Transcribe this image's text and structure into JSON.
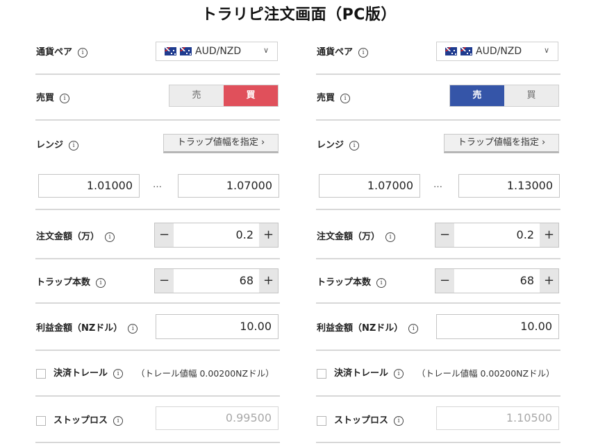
{
  "title": "トラリピ注文画面（PC版）",
  "labels": {
    "currency_pair": "通貨ペア",
    "buy_sell": "売買",
    "range": "レンジ",
    "order_amount": "注文金額（万）",
    "trap_count": "トラップ本数",
    "profit_amount": "利益金額（NZドル）",
    "trail": "決済トレール",
    "stop_loss": "ストップロス"
  },
  "info_symbol": "i",
  "sell_label": "売",
  "buy_label": "買",
  "range_button": "トラップ値幅を指定 ›",
  "range_dots": "…",
  "minus": "−",
  "plus": "+",
  "chevron": "∨",
  "colors": {
    "buy": "#e0505b",
    "sell": "#3555a8"
  },
  "panels": [
    {
      "pair": "AUD/NZD",
      "side_selected": "buy",
      "range_low": "1.01000",
      "range_high": "1.07000",
      "order_amount": "0.2",
      "trap_count": "68",
      "profit": "10.00",
      "trail_note": "（トレール値幅 0.00200NZドル）",
      "trail_checked": false,
      "stop_loss_checked": false,
      "stop_loss_value": "0.99500"
    },
    {
      "pair": "AUD/NZD",
      "side_selected": "sell",
      "range_low": "1.07000",
      "range_high": "1.13000",
      "order_amount": "0.2",
      "trap_count": "68",
      "profit": "10.00",
      "trail_note": "（トレール値幅 0.00200NZドル）",
      "trail_checked": false,
      "stop_loss_checked": false,
      "stop_loss_value": "1.10500"
    }
  ]
}
